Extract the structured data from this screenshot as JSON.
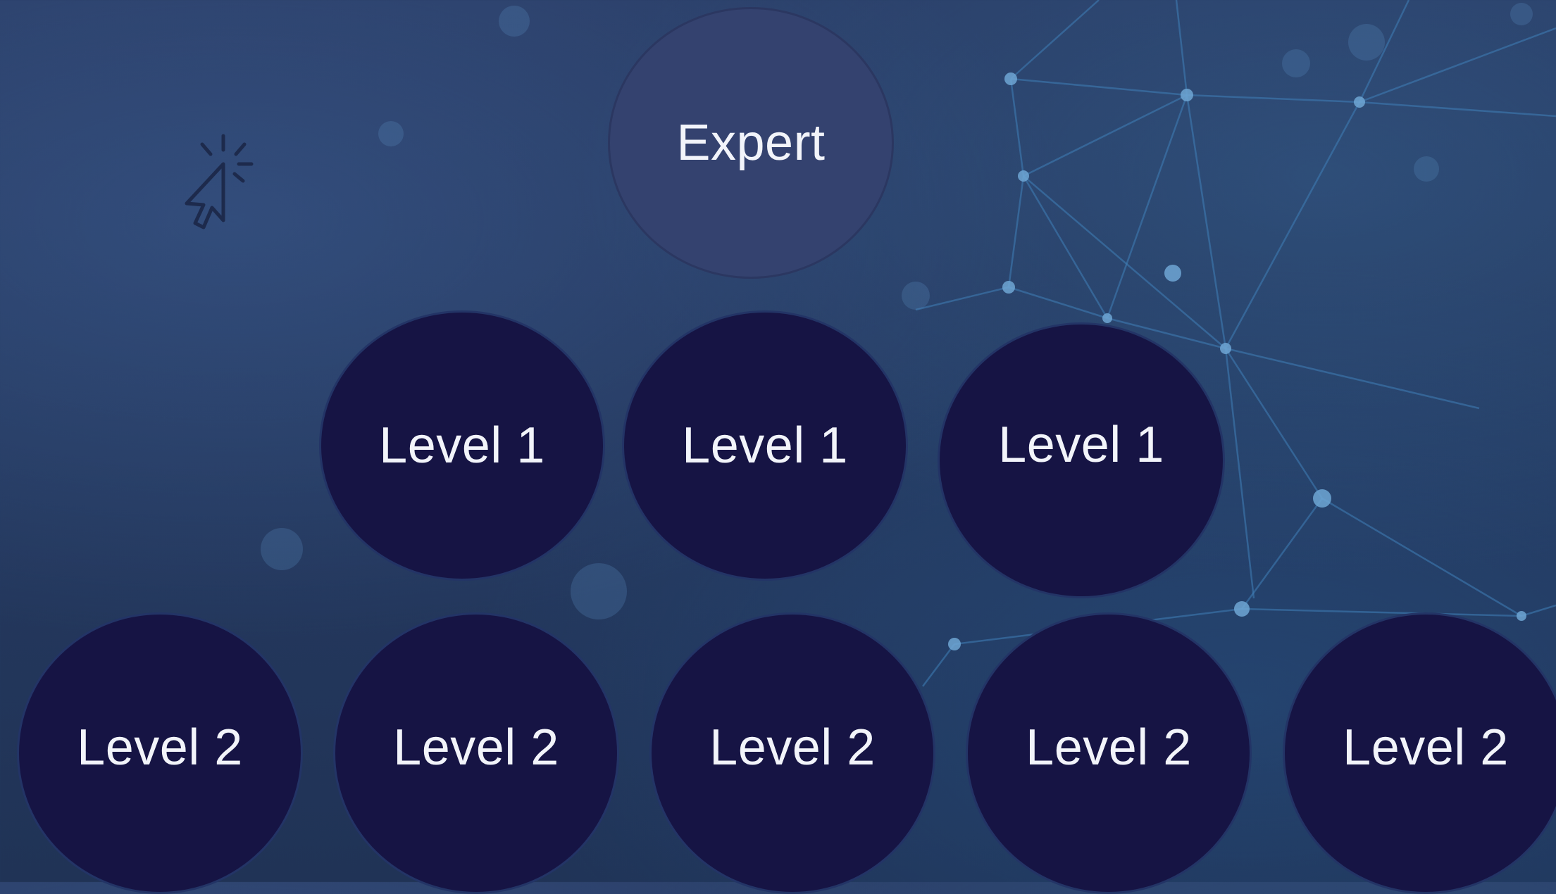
{
  "nodes": {
    "expert": {
      "label": "Expert"
    },
    "level1": [
      {
        "label": "Level 1"
      },
      {
        "label": "Level 1"
      },
      {
        "label": "Level 1"
      }
    ],
    "level2": [
      {
        "label": "Level 2"
      },
      {
        "label": "Level 2"
      },
      {
        "label": "Level 2"
      },
      {
        "label": "Level 2"
      },
      {
        "label": "Level 2"
      }
    ]
  },
  "icons": {
    "cursor": "click-cursor-icon"
  },
  "colors": {
    "background": "#25395f",
    "expert_fill": "#34426f",
    "level_fill": "#161444",
    "label_text": "#f2f4fa"
  }
}
